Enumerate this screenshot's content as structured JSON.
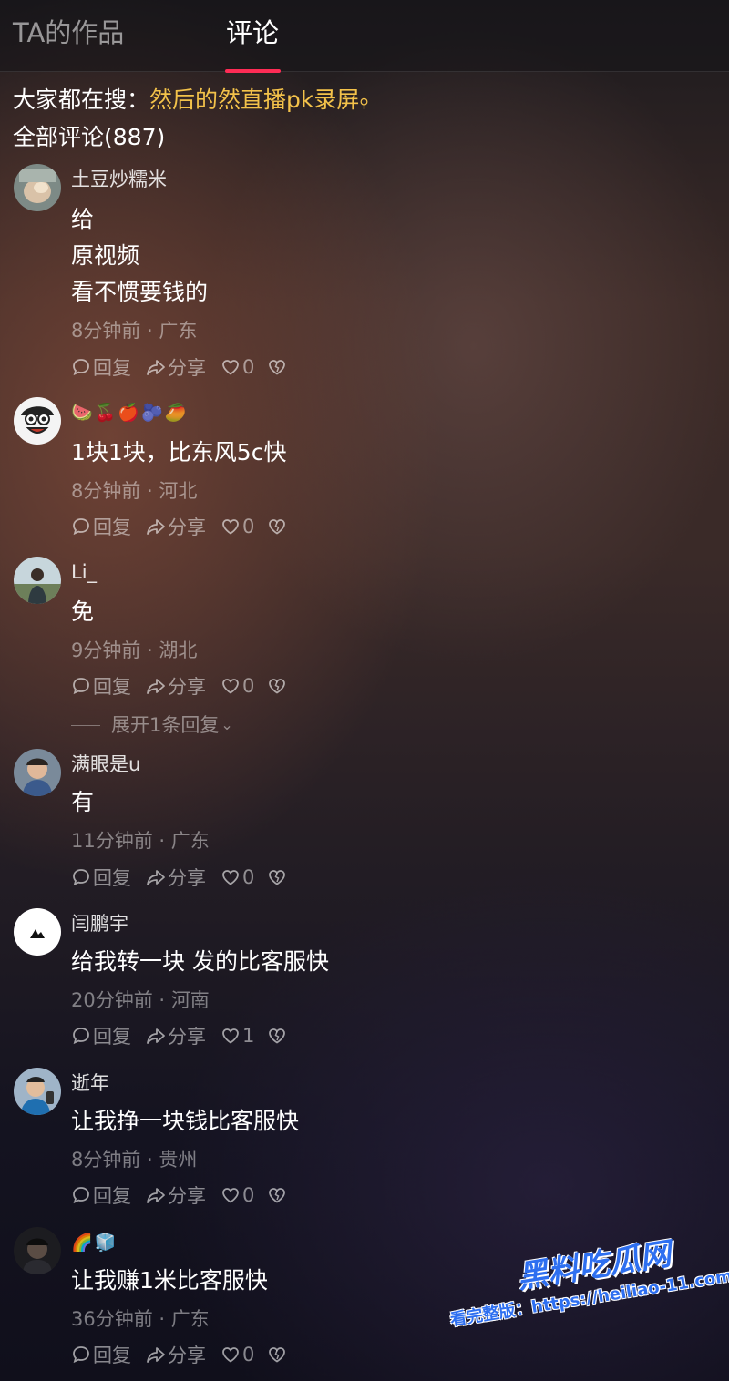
{
  "tabs": {
    "works": "TA的作品",
    "comments": "评论"
  },
  "search": {
    "label": "大家都在搜：",
    "query": "然后的然直播pk录屏",
    "icon": "search-icon"
  },
  "comment_count_label": "全部评论(887)",
  "actions": {
    "reply": "回复",
    "share": "分享"
  },
  "comments": [
    {
      "username": "土豆炒糯米",
      "lines": [
        "给",
        "原视频",
        "看不惯要钱的"
      ],
      "meta": "8分钟前 · 广东",
      "likes": "0"
    },
    {
      "username": "🍉🍒🍎🫐🥭",
      "lines": [
        "1块1块，比东风5c快"
      ],
      "meta": "8分钟前 · 河北",
      "likes": "0"
    },
    {
      "username": "Li_",
      "lines": [
        "免"
      ],
      "meta": "9分钟前 · 湖北",
      "likes": "0",
      "expand": "展开1条回复"
    },
    {
      "username": "满眼是u",
      "lines": [
        "有"
      ],
      "meta": "11分钟前 · 广东",
      "likes": "0"
    },
    {
      "username": "闫鹏宇",
      "lines": [
        "给我转一块 发的比客服快"
      ],
      "meta": "20分钟前 · 河南",
      "likes": "1"
    },
    {
      "username": "逝年",
      "lines": [
        "让我挣一块钱比客服快"
      ],
      "meta": "8分钟前 · 贵州",
      "likes": "0"
    },
    {
      "username": "🌈🧊",
      "lines": [
        "让我赚1米比客服快"
      ],
      "meta": "36分钟前 · 广东",
      "likes": "0"
    }
  ],
  "watermark": {
    "logo": "黑料吃瓜网",
    "url": "看完整版：https://heiliao-11.com"
  }
}
